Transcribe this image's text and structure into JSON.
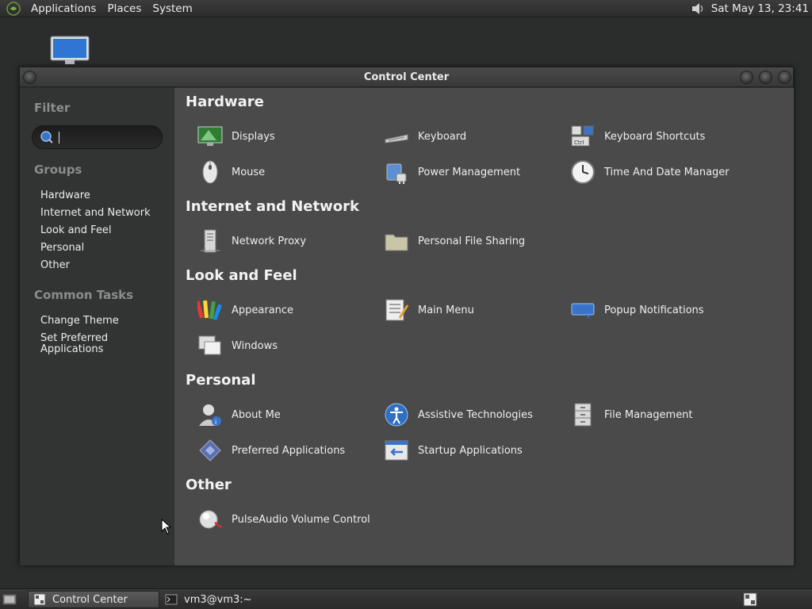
{
  "top_panel": {
    "menus": [
      "Applications",
      "Places",
      "System"
    ],
    "clock": "Sat May 13, 23:41"
  },
  "window": {
    "title": "Control Center"
  },
  "sidebar": {
    "filter_heading": "Filter",
    "search_value": "",
    "groups_heading": "Groups",
    "groups": [
      "Hardware",
      "Internet and Network",
      "Look and Feel",
      "Personal",
      "Other"
    ],
    "tasks_heading": "Common Tasks",
    "tasks": [
      "Change Theme",
      "Set Preferred Applications"
    ]
  },
  "main": {
    "groups": [
      {
        "title": "Hardware",
        "items": [
          "Displays",
          "Keyboard",
          "Keyboard Shortcuts",
          "Mouse",
          "Power Management",
          "Time And Date Manager"
        ]
      },
      {
        "title": "Internet and Network",
        "items": [
          "Network Proxy",
          "Personal File Sharing"
        ]
      },
      {
        "title": "Look and Feel",
        "items": [
          "Appearance",
          "Main Menu",
          "Popup Notifications",
          "Windows"
        ]
      },
      {
        "title": "Personal",
        "items": [
          "About Me",
          "Assistive Technologies",
          "File Management",
          "Preferred Applications",
          "Startup Applications"
        ]
      },
      {
        "title": "Other",
        "items": [
          "PulseAudio Volume Control"
        ]
      }
    ]
  },
  "taskbar": {
    "tasks": [
      "Control Center",
      "vm3@vm3:~"
    ]
  },
  "colors": {
    "panel_bg": "#2c2c2c",
    "sidebar_bg": "#323433",
    "main_bg": "#4a4a4a",
    "accent_blue": "#3a74c8"
  }
}
